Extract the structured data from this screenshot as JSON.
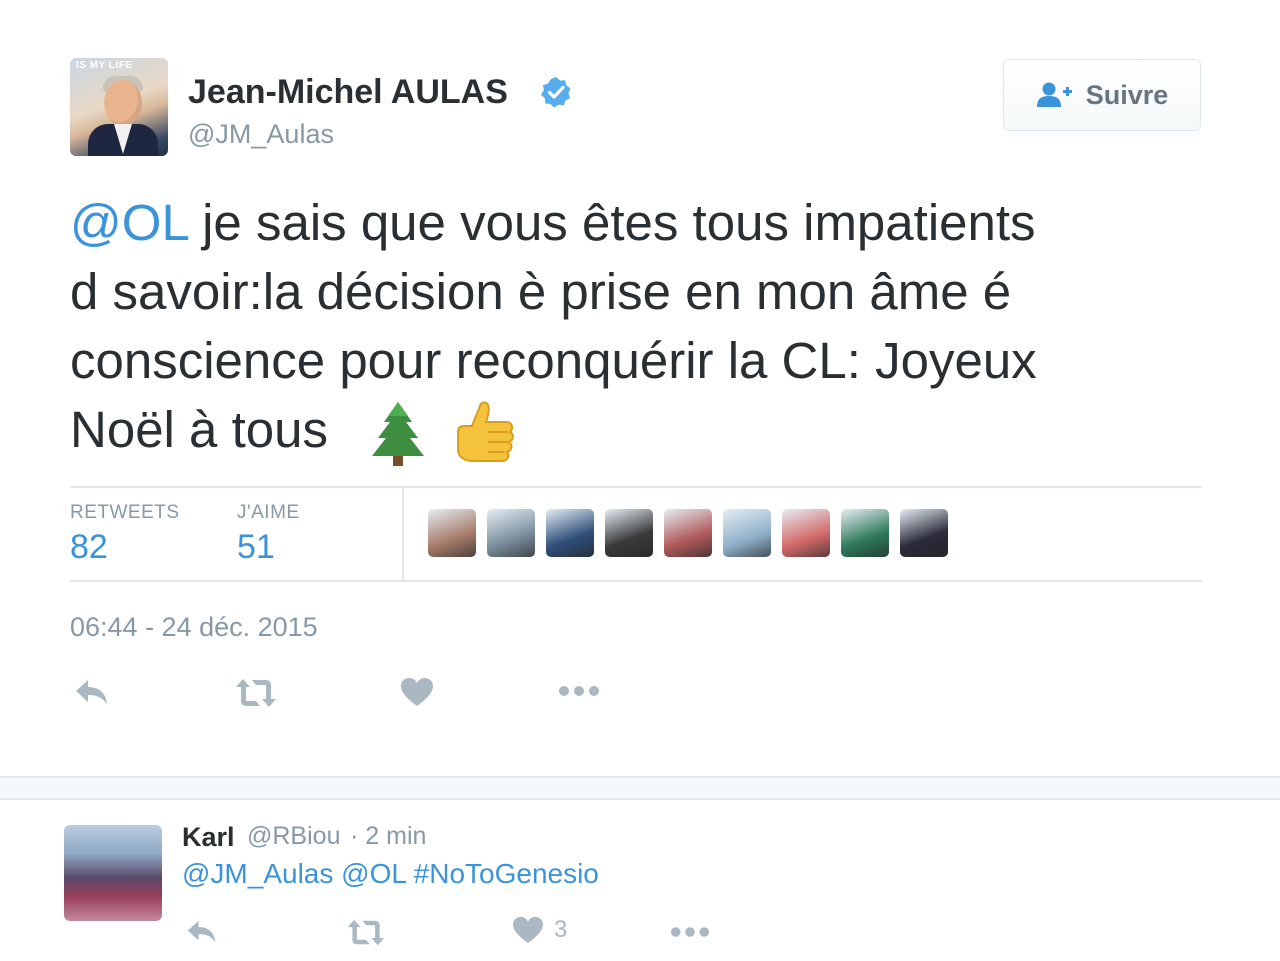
{
  "tweet": {
    "author": {
      "name": "Jean-Michel AULAS",
      "handle": "@JM_Aulas",
      "avatar_badge_text": "IS MY LIFE"
    },
    "follow_button_label": "Suivre",
    "text": {
      "mention": "@OL",
      "line1_rest": " je sais que vous êtes tous impatients",
      "line2": "d savoir:la décision è prise en mon âme é",
      "line3": "conscience pour reconquérir la CL: Joyeux",
      "line4": "Noël à tous"
    },
    "emojis": [
      "christmas-tree",
      "thumbs-up"
    ],
    "stats": {
      "retweets_label": "RETWEETS",
      "retweets_value": "82",
      "likes_label": "J'AIME",
      "likes_value": "51"
    },
    "timestamp": "06:44 - 24 déc. 2015",
    "liker_colors": [
      "#a67c6a",
      "#7a8f9e",
      "#2f4f7a",
      "#3a3a3a",
      "#b05a5a",
      "#8fb0c9",
      "#d46a6a",
      "#2f7a5a",
      "#2b2b3a"
    ]
  },
  "reply": {
    "name": "Karl",
    "handle": "@RBiou",
    "time": "· 2 min",
    "text": "@JM_Aulas @OL #NoToGenesio",
    "like_count": "3"
  },
  "colors": {
    "link": "#3b94d9",
    "muted": "#8899a6",
    "icon": "#aab8c2",
    "verified": "#55acee"
  }
}
